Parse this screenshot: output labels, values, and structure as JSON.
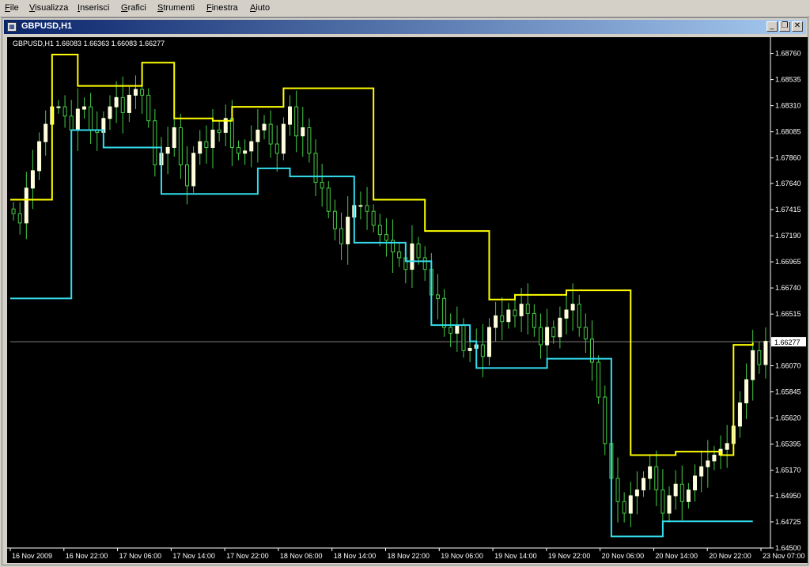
{
  "menu": {
    "items": [
      {
        "label": "File",
        "accel": "F",
        "rest": "ile"
      },
      {
        "label": "Visualizza",
        "accel": "V",
        "rest": "isualizza"
      },
      {
        "label": "Inserisci",
        "accel": "I",
        "rest": "nserisci"
      },
      {
        "label": "Grafici",
        "accel": "G",
        "rest": "rafici"
      },
      {
        "label": "Strumenti",
        "accel": "S",
        "rest": "trumenti"
      },
      {
        "label": "Finestra",
        "accel": "F",
        "rest": "inestra"
      },
      {
        "label": "Aiuto",
        "accel": "A",
        "rest": "iuto"
      }
    ]
  },
  "window": {
    "title": "GBPUSD,H1",
    "buttons": {
      "minimize": "_",
      "restore": "❐",
      "close": "✕"
    }
  },
  "chart_info": {
    "symbol": "GBPUSD,H1",
    "ohlc": "1.66083 1.66363 1.66083 1.66277"
  },
  "chart_data": {
    "type": "candlestick",
    "symbol": "GBPUSD",
    "timeframe": "H1",
    "current_price": "1.66277",
    "y_ticks": [
      "1.68760",
      "1.68535",
      "1.68310",
      "1.68085",
      "1.67860",
      "1.67640",
      "1.67415",
      "1.67190",
      "1.66965",
      "1.66740",
      "1.66515",
      "1.66277",
      "1.66070",
      "1.65845",
      "1.65620",
      "1.65395",
      "1.65170",
      "1.64950",
      "1.64725",
      "1.64500"
    ],
    "ylim": [
      1.645,
      1.689
    ],
    "x_ticks": [
      "16 Nov 2009",
      "16 Nov 22:00",
      "17 Nov 06:00",
      "17 Nov 14:00",
      "17 Nov 22:00",
      "18 Nov 06:00",
      "18 Nov 14:00",
      "18 Nov 22:00",
      "19 Nov 06:00",
      "19 Nov 14:00",
      "19 Nov 22:00",
      "20 Nov 06:00",
      "20 Nov 14:00",
      "20 Nov 22:00",
      "23 Nov 07:00"
    ],
    "colors": {
      "background": "#000000",
      "candle_up_body": "#ffffdd",
      "candle_down_body": "#000000",
      "wick": "#44cc44",
      "upper_channel": "#ffff00",
      "lower_channel": "#33ddee",
      "price_line": "#808080",
      "axis_text": "#ffffff"
    },
    "upper_channel": [
      {
        "bar": 0,
        "y": 1.675
      },
      {
        "bar": 6,
        "y": 1.6875
      },
      {
        "bar": 10,
        "y": 1.6848
      },
      {
        "bar": 20,
        "y": 1.6868
      },
      {
        "bar": 25,
        "y": 1.682
      },
      {
        "bar": 31,
        "y": 1.6818
      },
      {
        "bar": 34,
        "y": 1.683
      },
      {
        "bar": 42,
        "y": 1.6846
      },
      {
        "bar": 56,
        "y": 1.675
      },
      {
        "bar": 64,
        "y": 1.6723
      },
      {
        "bar": 74,
        "y": 1.6664
      },
      {
        "bar": 78,
        "y": 1.6668
      },
      {
        "bar": 86,
        "y": 1.6672
      },
      {
        "bar": 96,
        "y": 1.653
      },
      {
        "bar": 103,
        "y": 1.6533
      },
      {
        "bar": 110,
        "y": 1.653
      },
      {
        "bar": 112,
        "y": 1.6625
      },
      {
        "bar": 115,
        "y": 1.6627
      }
    ],
    "lower_channel": [
      {
        "bar": 0,
        "y": 1.6665
      },
      {
        "bar": 7,
        "y": 1.6665
      },
      {
        "bar": 9,
        "y": 1.681
      },
      {
        "bar": 14,
        "y": 1.6795
      },
      {
        "bar": 22,
        "y": 1.6795
      },
      {
        "bar": 23,
        "y": 1.6755
      },
      {
        "bar": 37,
        "y": 1.6755
      },
      {
        "bar": 38,
        "y": 1.6777
      },
      {
        "bar": 43,
        "y": 1.677
      },
      {
        "bar": 53,
        "y": 1.6713
      },
      {
        "bar": 61,
        "y": 1.6697
      },
      {
        "bar": 65,
        "y": 1.6642
      },
      {
        "bar": 71,
        "y": 1.6628
      },
      {
        "bar": 72,
        "y": 1.6605
      },
      {
        "bar": 83,
        "y": 1.6613
      },
      {
        "bar": 92,
        "y": 1.6613
      },
      {
        "bar": 93,
        "y": 1.646
      },
      {
        "bar": 101,
        "y": 1.6473
      },
      {
        "bar": 115,
        "y": 1.6473
      }
    ],
    "candles_close": [
      1.6738,
      1.673,
      1.676,
      1.6775,
      1.68,
      1.6815,
      1.683,
      1.683,
      1.6822,
      1.681,
      1.6828,
      1.683,
      1.681,
      1.6808,
      1.682,
      1.683,
      1.6838,
      1.6825,
      1.684,
      1.6845,
      1.684,
      1.6818,
      1.678,
      1.679,
      1.6795,
      1.6812,
      1.678,
      1.6762,
      1.679,
      1.68,
      1.6795,
      1.681,
      1.6808,
      1.682,
      1.6795,
      1.679,
      1.6792,
      1.68,
      1.681,
      1.6815,
      1.6798,
      1.679,
      1.6815,
      1.683,
      1.6805,
      1.6812,
      1.679,
      1.6765,
      1.676,
      1.674,
      1.6725,
      1.6712,
      1.6735,
      1.6745,
      1.6745,
      1.674,
      1.6728,
      1.672,
      1.6715,
      1.6705,
      1.67,
      1.669,
      1.6712,
      1.67,
      1.669,
      1.6668,
      1.6665,
      1.664,
      1.6635,
      1.6642,
      1.662,
      1.6622,
      1.6625,
      1.6615,
      1.664,
      1.665,
      1.6645,
      1.6655,
      1.665,
      1.666,
      1.6652,
      1.664,
      1.6625,
      1.664,
      1.6632,
      1.6648,
      1.6655,
      1.666,
      1.664,
      1.663,
      1.661,
      1.658,
      1.654,
      1.651,
      1.649,
      1.648,
      1.6495,
      1.65,
      1.651,
      1.652,
      1.65,
      1.648,
      1.6495,
      1.6505,
      1.649,
      1.65,
      1.6512,
      1.652,
      1.6525,
      1.653,
      1.6535,
      1.654,
      1.6555,
      1.6575,
      1.6595,
      1.662,
      1.6608,
      1.6628
    ]
  }
}
